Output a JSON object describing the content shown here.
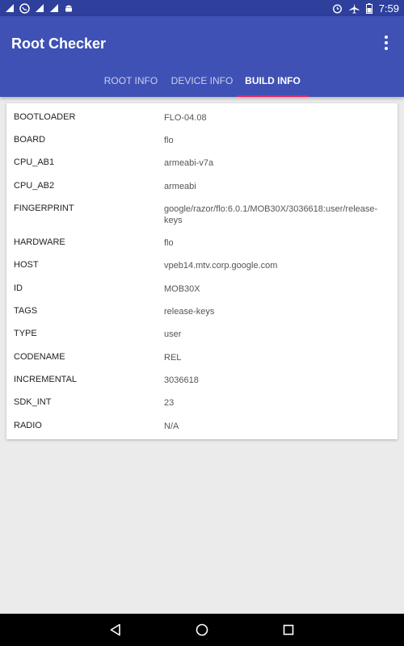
{
  "status_bar": {
    "time": "7:59",
    "left_icons": [
      "signal-icon",
      "whatsapp-icon",
      "signal-icon",
      "signal-icon",
      "android-icon"
    ],
    "right_icons": [
      "alarm-icon",
      "airplane-icon",
      "battery-icon"
    ]
  },
  "app_bar": {
    "title": "Root Checker",
    "menu_icon": "more-vert-icon"
  },
  "tabs": [
    {
      "label": "ROOT INFO",
      "active": false
    },
    {
      "label": "DEVICE INFO",
      "active": false
    },
    {
      "label": "BUILD INFO",
      "active": true
    }
  ],
  "build_info": [
    {
      "key": "BOOTLOADER",
      "value": "FLO-04.08"
    },
    {
      "key": "BOARD",
      "value": "flo"
    },
    {
      "key": "CPU_AB1",
      "value": "armeabi-v7a"
    },
    {
      "key": "CPU_AB2",
      "value": "armeabi"
    },
    {
      "key": "FINGERPRINT",
      "value": "google/razor/flo:6.0.1/MOB30X/3036618:user/release-keys"
    },
    {
      "key": "HARDWARE",
      "value": "flo"
    },
    {
      "key": "HOST",
      "value": "vpeb14.mtv.corp.google.com"
    },
    {
      "key": "ID",
      "value": "MOB30X"
    },
    {
      "key": "TAGS",
      "value": "release-keys"
    },
    {
      "key": "TYPE",
      "value": "user"
    },
    {
      "key": "CODENAME",
      "value": "REL"
    },
    {
      "key": "INCREMENTAL",
      "value": "3036618"
    },
    {
      "key": "SDK_INT",
      "value": "23"
    },
    {
      "key": "RADIO",
      "value": "N/A"
    }
  ],
  "nav_bar": {
    "buttons": [
      "back-icon",
      "home-icon",
      "recents-icon"
    ]
  },
  "colors": {
    "status_bar": "#2e3f9c",
    "app_bar": "#3f51b5",
    "tab_indicator": "#e91e63",
    "background": "#ebebeb"
  }
}
